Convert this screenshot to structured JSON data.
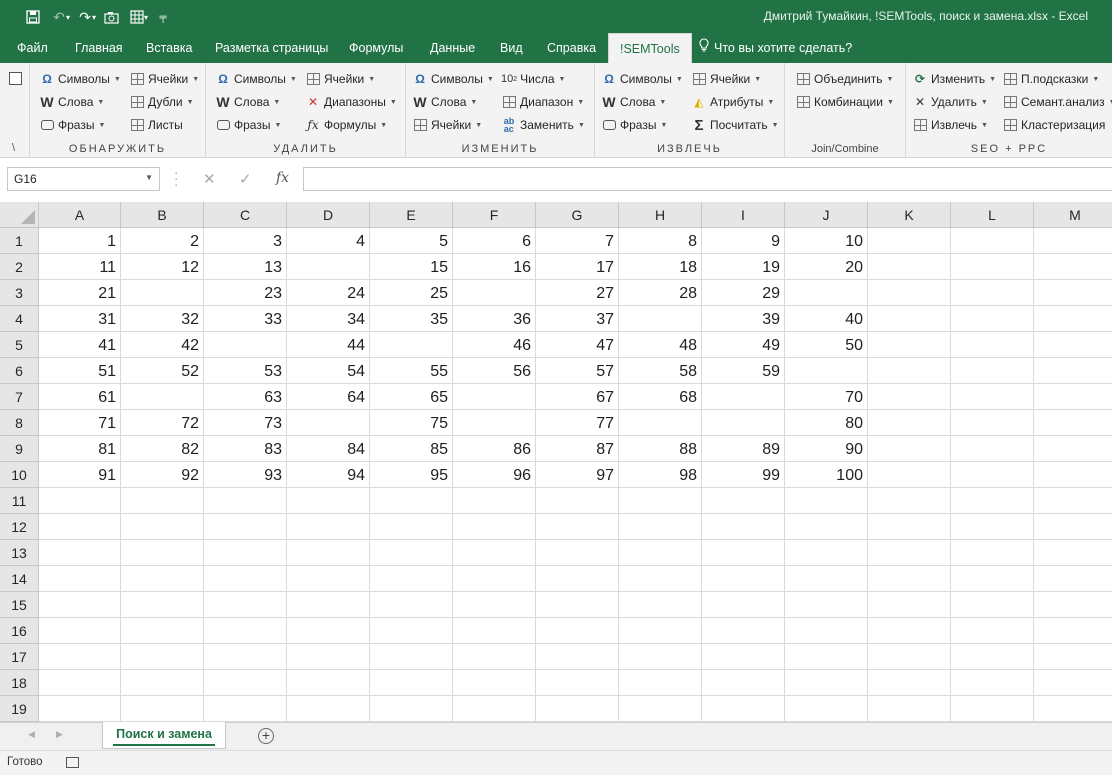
{
  "window": {
    "title": "Дмитрий Тумайкин, !SEMTools, поиск и замена.xlsx  -  Excel"
  },
  "tabs": [
    {
      "id": "file",
      "label": "Файл"
    },
    {
      "id": "home",
      "label": "Главная"
    },
    {
      "id": "insert",
      "label": "Вставка"
    },
    {
      "id": "layout",
      "label": "Разметка страницы"
    },
    {
      "id": "formulas",
      "label": "Формулы"
    },
    {
      "id": "data",
      "label": "Данные"
    },
    {
      "id": "view",
      "label": "Вид"
    },
    {
      "id": "help",
      "label": "Справка"
    },
    {
      "id": "semtools",
      "label": "!SEMTools"
    }
  ],
  "tellme": "Что вы хотите сделать?",
  "ribbon": {
    "groups": {
      "detect": "ОБНАРУЖИТЬ",
      "remove": "УДАЛИТЬ",
      "change": "ИЗМЕНИТЬ",
      "extract": "ИЗВЛЕЧЬ",
      "join": "Join/Combine",
      "seo": "SEO + PPC"
    },
    "detect": {
      "symbols": "Символы",
      "words": "Слова",
      "phrases": "Фразы",
      "cells": "Ячейки",
      "dups": "Дубли",
      "sheets": "Листы"
    },
    "remove": {
      "symbols": "Символы",
      "words": "Слова",
      "phrases": "Фразы",
      "cells": "Ячейки",
      "ranges": "Диапазоны",
      "formulas": "Формулы"
    },
    "change": {
      "symbols": "Символы",
      "words": "Слова",
      "cells": "Ячейки",
      "numbers": "Числа",
      "range": "Диапазон",
      "replace": "Заменить",
      "ten": "10",
      "exp": "2"
    },
    "extract": {
      "symbols": "Символы",
      "words": "Слова",
      "phrases": "Фразы",
      "cells": "Ячейки",
      "attributes": "Атрибуты",
      "count": "Посчитать"
    },
    "join": {
      "merge": "Объединить",
      "combos": "Комбинации"
    },
    "seo": {
      "change": "Изменить",
      "delete": "Удалить",
      "extract": "Извлечь",
      "hints": "П.подсказки",
      "semantic": "Семант.анализ",
      "cluster": "Кластеризация"
    }
  },
  "formula_bar": {
    "name_box": "G16",
    "formula": ""
  },
  "columns": [
    "A",
    "B",
    "C",
    "D",
    "E",
    "F",
    "G",
    "H",
    "I",
    "J",
    "K",
    "L",
    "M"
  ],
  "rows": [
    "1",
    "2",
    "3",
    "4",
    "5",
    "6",
    "7",
    "8",
    "9",
    "10",
    "11",
    "12",
    "13",
    "14",
    "15",
    "16",
    "17",
    "18",
    "19"
  ],
  "cells": [
    [
      "1",
      "2",
      "3",
      "4",
      "5",
      "6",
      "7",
      "8",
      "9",
      "10",
      "",
      "",
      ""
    ],
    [
      "11",
      "12",
      "13",
      "",
      "15",
      "16",
      "17",
      "18",
      "19",
      "20",
      "",
      "",
      ""
    ],
    [
      "21",
      "",
      "23",
      "24",
      "25",
      "",
      "27",
      "28",
      "29",
      "",
      "",
      "",
      ""
    ],
    [
      "31",
      "32",
      "33",
      "34",
      "35",
      "36",
      "37",
      "",
      "39",
      "40",
      "",
      "",
      ""
    ],
    [
      "41",
      "42",
      "",
      "44",
      "",
      "46",
      "47",
      "48",
      "49",
      "50",
      "",
      "",
      ""
    ],
    [
      "51",
      "52",
      "53",
      "54",
      "55",
      "56",
      "57",
      "58",
      "59",
      "",
      "",
      "",
      ""
    ],
    [
      "61",
      "",
      "63",
      "64",
      "65",
      "",
      "67",
      "68",
      "",
      "70",
      "",
      "",
      ""
    ],
    [
      "71",
      "72",
      "73",
      "",
      "75",
      "",
      "77",
      "",
      "",
      "80",
      "",
      "",
      ""
    ],
    [
      "81",
      "82",
      "83",
      "84",
      "85",
      "86",
      "87",
      "88",
      "89",
      "90",
      "",
      "",
      ""
    ],
    [
      "91",
      "92",
      "93",
      "94",
      "95",
      "96",
      "97",
      "98",
      "99",
      "100",
      "",
      "",
      ""
    ],
    [
      "",
      "",
      "",
      "",
      "",
      "",
      "",
      "",
      "",
      "",
      "",
      "",
      ""
    ],
    [
      "",
      "",
      "",
      "",
      "",
      "",
      "",
      "",
      "",
      "",
      "",
      "",
      ""
    ],
    [
      "",
      "",
      "",
      "",
      "",
      "",
      "",
      "",
      "",
      "",
      "",
      "",
      ""
    ],
    [
      "",
      "",
      "",
      "",
      "",
      "",
      "",
      "",
      "",
      "",
      "",
      "",
      ""
    ],
    [
      "",
      "",
      "",
      "",
      "",
      "",
      "",
      "",
      "",
      "",
      "",
      "",
      ""
    ],
    [
      "",
      "",
      "",
      "",
      "",
      "",
      "",
      "",
      "",
      "",
      "",
      "",
      ""
    ],
    [
      "",
      "",
      "",
      "",
      "",
      "",
      "",
      "",
      "",
      "",
      "",
      "",
      ""
    ],
    [
      "",
      "",
      "",
      "",
      "",
      "",
      "",
      "",
      "",
      "",
      "",
      "",
      ""
    ],
    [
      "",
      "",
      "",
      "",
      "",
      "",
      "",
      "",
      "",
      "",
      "",
      "",
      ""
    ]
  ],
  "sheet": {
    "name": "Поиск и замена",
    "add": "+"
  },
  "status": {
    "text": "Готово"
  },
  "colors": {
    "accent": "#217346"
  }
}
